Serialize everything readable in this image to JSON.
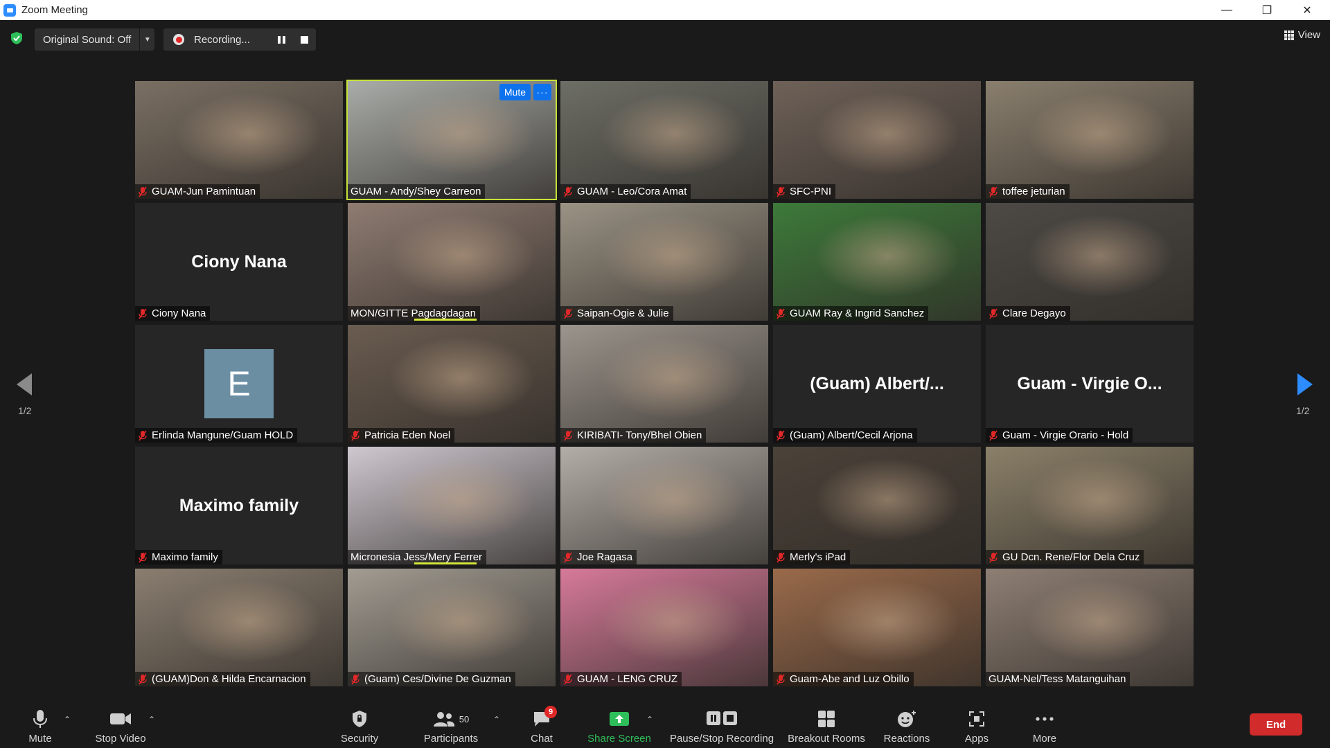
{
  "window": {
    "title": "Zoom Meeting"
  },
  "top": {
    "original_sound": "Original Sound: Off",
    "recording": "Recording...",
    "view": "View"
  },
  "pager": {
    "left": "1/2",
    "right": "1/2"
  },
  "active_controls": {
    "mute": "Mute",
    "more": "···"
  },
  "tiles": [
    {
      "name": "GUAM-Jun Pamintuan",
      "color": "#7a6f63"
    },
    {
      "name": "GUAM - Andy/Shey Carreon",
      "color": "#a9aca8"
    },
    {
      "name": "GUAM - Leo/Cora Amat",
      "color": "#6d6e66"
    },
    {
      "name": "SFC-PNI",
      "color": "#6e6158"
    },
    {
      "name": "toffee jeturian",
      "color": "#8a7f6e"
    },
    {
      "name": "Ciony Nana",
      "big": "Ciony Nana"
    },
    {
      "name": "MON/GITTE Pagdagdagan",
      "color": "#8f7c72"
    },
    {
      "name": "Saipan-Ogie & Julie",
      "color": "#9a9385"
    },
    {
      "name": "GUAM Ray & Ingrid Sanchez",
      "color": "#3d7a3a"
    },
    {
      "name": "Clare Degayo",
      "color": "#4d4a46"
    },
    {
      "name": "Erlinda Mangune/Guam HOLD",
      "avatar": "E"
    },
    {
      "name": "Patricia Eden Noel",
      "color": "#6a5c50"
    },
    {
      "name": "KIRIBATI- Tony/Bhel Obien",
      "color": "#9c958d"
    },
    {
      "name": "(Guam) Albert/Cecil Arjona",
      "big": "(Guam)  Albert/..."
    },
    {
      "name": "Guam - Virgie Orario - Hold",
      "big": "Guam  - Virgie O..."
    },
    {
      "name": "Maximo family",
      "big": "Maximo family"
    },
    {
      "name": "Micronesia Jess/Mery Ferrer",
      "color": "#cfc8d0"
    },
    {
      "name": "Joe Ragasa",
      "color": "#b4aea8"
    },
    {
      "name": "Merly's iPad",
      "color": "#4b4239"
    },
    {
      "name": "GU Dcn. Rene/Flor Dela Cruz",
      "color": "#8b8069"
    },
    {
      "name": "(GUAM)Don & Hilda Encarnacion",
      "color": "#8a7e70"
    },
    {
      "name": "(Guam) Ces/Divine De Guzman",
      "color": "#a29c92"
    },
    {
      "name": "GUAM - LENG CRUZ",
      "color": "#d77a9a"
    },
    {
      "name": "Guam-Abe and Luz Obillo",
      "color": "#9a6a4a"
    },
    {
      "name": "GUAM-Nel/Tess Matanguihan",
      "color": "#8e7f74"
    }
  ],
  "toolbar": {
    "mute": "Mute",
    "stop_video": "Stop Video",
    "security": "Security",
    "participants": "Participants",
    "participant_count": "50",
    "chat": "Chat",
    "chat_badge": "9",
    "share_screen": "Share Screen",
    "pause_stop_recording": "Pause/Stop Recording",
    "breakout_rooms": "Breakout Rooms",
    "reactions": "Reactions",
    "apps": "Apps",
    "more": "More",
    "end": "End"
  },
  "colors": {
    "accent_blue": "#0e72ed",
    "share_green": "#2fbf5a",
    "end_red": "#d12b2b",
    "speaker_outline": "#c6e23a"
  }
}
